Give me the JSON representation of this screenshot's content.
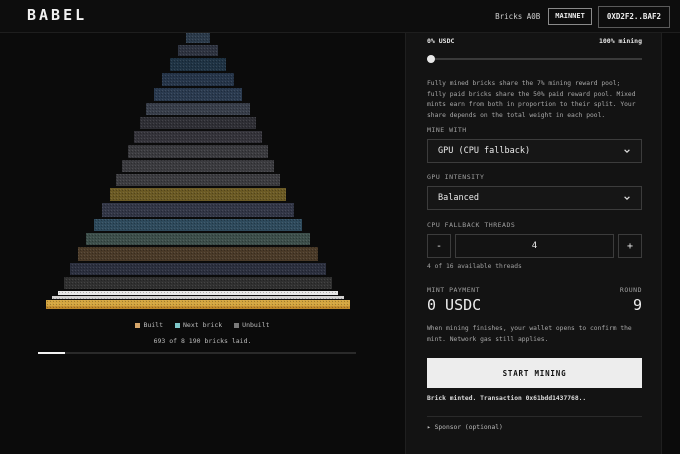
{
  "header": {
    "logo": "BABEL",
    "bricks_label": "Bricks A0B",
    "network": "MAINNET",
    "wallet": "0XD2F2..BAF2"
  },
  "pyramid": {
    "legend": [
      {
        "label": "Built",
        "color": "#d6a66a"
      },
      {
        "label": "Next brick",
        "color": "#7fc7c9"
      },
      {
        "label": "Unbuilt",
        "color": "#7a7a7a"
      }
    ],
    "count_text": "693 of 8 190 bricks laid.",
    "progress": 0.085
  },
  "panel": {
    "slider_left": "0% USDC",
    "slider_right": "100% mining",
    "slider_value": 0,
    "description": "Fully mined bricks share the 7% mining reward pool; fully paid bricks share the 50% paid reward pool. Mixed mints earn from both in proportion to their split. Your share depends on the total weight in each pool.",
    "mine_with_label": "MINE WITH",
    "mine_with_value": "GPU (CPU fallback)",
    "intensity_label": "GPU INTENSITY",
    "intensity_value": "Balanced",
    "threads_label": "CPU FALLBACK THREADS",
    "threads_minus": "-",
    "threads_value": "4",
    "threads_plus": "+",
    "threads_hint": "4 of 16 available threads",
    "mint_payment_label": "MINT PAYMENT",
    "mint_payment_value": "0 USDC",
    "round_label": "ROUND",
    "round_value": "9",
    "note": "When mining finishes, your wallet opens to confirm the mint. Network gas still applies.",
    "start_button": "START MINING",
    "status": "Brick minted. Transaction 0x61bdd1437768..",
    "sponsor": "▸ Sponsor (optional)"
  }
}
